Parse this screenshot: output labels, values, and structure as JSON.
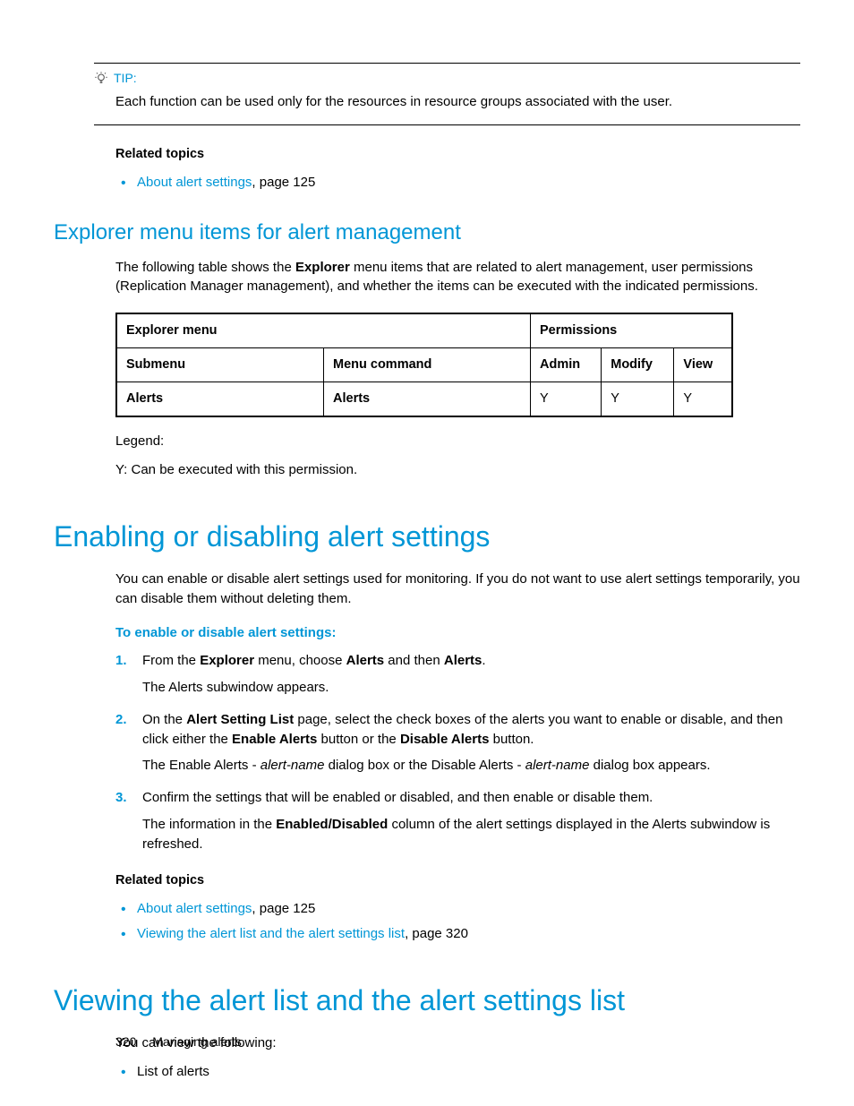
{
  "tip": {
    "label": "TIP:",
    "text": "Each function can be used only for the resources in resource groups associated with the user."
  },
  "related1": {
    "heading": "Related topics",
    "items": [
      {
        "link": "About alert settings",
        "rest": ", page 125"
      }
    ]
  },
  "section_explorer": {
    "heading": "Explorer menu items for alert management",
    "intro_pre": "The following table shows the ",
    "intro_bold": "Explorer",
    "intro_post": " menu items that are related to alert management, user permissions (Replication Manager management), and whether the items can be executed with the indicated permissions."
  },
  "table": {
    "h_explorer": "Explorer menu",
    "h_permissions": "Permissions",
    "h_submenu": "Submenu",
    "h_menucmd": "Menu command",
    "h_admin": "Admin",
    "h_modify": "Modify",
    "h_view": "View",
    "r_submenu": "Alerts",
    "r_menucmd": "Alerts",
    "r_admin": "Y",
    "r_modify": "Y",
    "r_view": "Y"
  },
  "legend": {
    "l1": "Legend:",
    "l2": "Y: Can be executed with this permission."
  },
  "section_enable": {
    "heading": "Enabling or disabling alert settings",
    "intro": "You can enable or disable alert settings used for monitoring. If you do not want to use alert settings temporarily, you can disable them without deleting them.",
    "proc_heading": "To enable or disable alert settings:",
    "step1": {
      "pre": "From the ",
      "b1": "Explorer",
      "mid1": " menu, choose ",
      "b2": "Alerts",
      "mid2": " and then ",
      "b3": "Alerts",
      "post": ".",
      "result": "The Alerts subwindow appears."
    },
    "step2": {
      "pre": "On the ",
      "b1": "Alert Setting List",
      "mid1": " page, select the check boxes of the alerts you want to enable or disable, and then click either the ",
      "b2": "Enable Alerts",
      "mid2": " button or the ",
      "b3": "Disable Alerts",
      "post": " button.",
      "result_pre": "The Enable Alerts - ",
      "result_i1": "alert-name",
      "result_mid": " dialog box or the Disable Alerts - ",
      "result_i2": "alert-name",
      "result_post": " dialog box appears."
    },
    "step3": {
      "text": "Confirm the settings that will be enabled or disabled, and then enable or disable them.",
      "result_pre": "The information in the ",
      "result_b": "Enabled/Disabled",
      "result_post": " column of the alert settings displayed in the Alerts subwindow is refreshed."
    }
  },
  "related2": {
    "heading": "Related topics",
    "items": [
      {
        "link": "About alert settings",
        "rest": ", page 125"
      },
      {
        "link": "Viewing the alert list and the alert settings list",
        "rest": ", page 320"
      }
    ]
  },
  "section_view": {
    "heading": "Viewing the alert list and the alert settings list",
    "intro": "You can view the following:",
    "items": [
      "List of alerts"
    ]
  },
  "footer": {
    "page": "320",
    "chapter": "Managing alerts"
  }
}
